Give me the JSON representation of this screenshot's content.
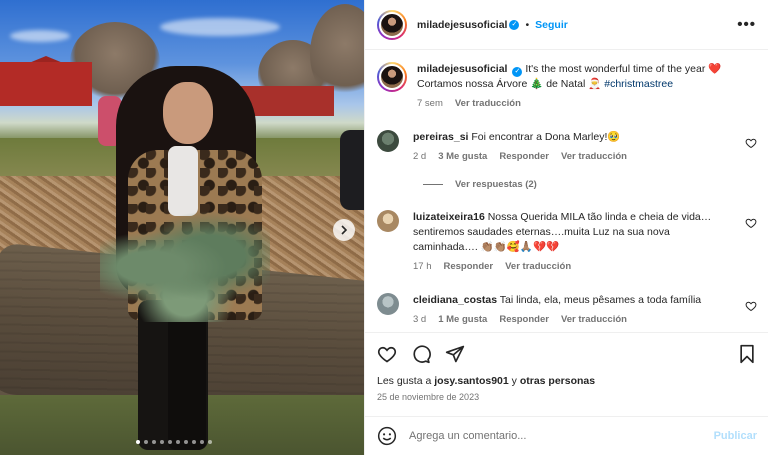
{
  "post": {
    "username": "miladejesusoficial",
    "follow_label": "Seguir",
    "separator": "•",
    "more_label": "•••",
    "caption_line1": "It's the most wonderful time of the year ❤️",
    "caption_line2": "Cortamos nossa Árvore 🎄 de Natal 🎅",
    "hashtag": "#christmastree",
    "caption_age": "7 sem",
    "caption_translate": "Ver traducción"
  },
  "comments": [
    {
      "username": "pereiras_si",
      "text": "Foi encontrar a Dona Marley!🥹",
      "age": "2 d",
      "likes": "3 Me gusta",
      "reply": "Responder",
      "translate": "Ver traducción",
      "view_replies": "Ver respuestas (2)"
    },
    {
      "username": "luizateixeira16",
      "text_line1": "Nossa Querida MILA tão linda e cheia de vida…",
      "text_line2": "sentiremos saudades eternas….muita Luz na sua nova",
      "text_line3": "caminhada…. 👏🏽👏🏽🥰🙏🏽💔💔",
      "age": "17 h",
      "reply": "Responder",
      "translate": "Ver traducción"
    },
    {
      "username": "cleidiana_costas",
      "text": "Tai linda, ela, meus pêsames a toda família",
      "age": "3 d",
      "likes": "1 Me gusta",
      "reply": "Responder",
      "translate": "Ver traducción"
    }
  ],
  "likes": {
    "prefix": "Les gusta a ",
    "user": "josy.santos901",
    "middle": " y ",
    "others": "otras personas"
  },
  "date": "25 de noviembre de 2023",
  "composer": {
    "placeholder": "Agrega un comentario...",
    "publish_label": "Publicar"
  },
  "carousel": {
    "slide_count": 10,
    "active_index": 0
  },
  "colors": {
    "accent": "#0095f6",
    "publish_disabled": "#b2dffc",
    "muted": "#737373",
    "hashtag": "#00376b"
  }
}
